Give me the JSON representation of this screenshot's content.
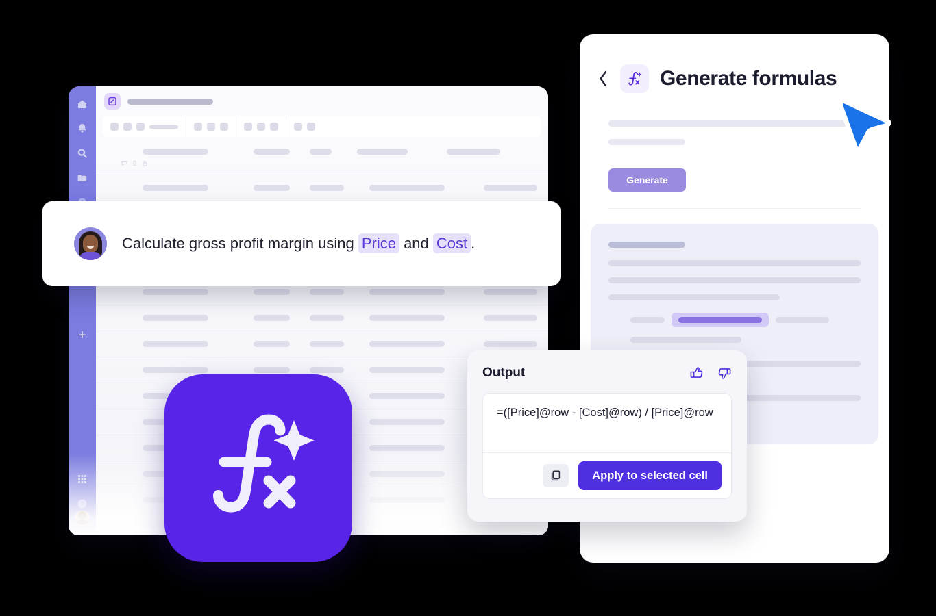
{
  "spreadsheet": {
    "sidebar": {
      "items": [
        {
          "name": "home-icon"
        },
        {
          "name": "notifications-bell-icon"
        },
        {
          "name": "search-icon"
        },
        {
          "name": "folder-icon"
        },
        {
          "name": "recents-clock-icon"
        }
      ],
      "add_label": "+",
      "bottom_items": [
        {
          "name": "apps-grid-icon"
        },
        {
          "name": "help-icon"
        }
      ],
      "avatar_name": "user-avatar"
    },
    "doc_icon_name": "sheet-document-icon",
    "toolbar_groups": [
      3,
      3,
      3,
      2
    ]
  },
  "panel": {
    "back_icon": "chevron-left-icon",
    "badge_icon": "formula-sparkle-icon",
    "title": "Generate formulas",
    "generate_label": "Generate"
  },
  "bubble": {
    "avatar_name": "person-avatar",
    "text_before": "Calculate gross profit margin using ",
    "chip_1": "Price",
    "text_middle": " and ",
    "chip_2": "Cost",
    "text_after": "."
  },
  "fx_app": {
    "icon_name": "formula-sparkle-app-icon"
  },
  "output": {
    "title": "Output",
    "thumbs_up_icon": "thumbs-up-icon",
    "thumbs_down_icon": "thumbs-down-icon",
    "formula": "=([Price]@row - [Cost]@row) / [Price]@row",
    "copy_icon": "copy-icon",
    "apply_label": "Apply to selected cell"
  },
  "cursor": {
    "name": "mouse-pointer-cursor",
    "color": "#1a73e8"
  },
  "colors": {
    "brand_purple": "#5724e8",
    "apply_purple": "#4f2fe0",
    "generate_purple": "#9b8ae0",
    "sidebar_purple": "#7b7be0",
    "chip_bg": "#e7e0fb",
    "chip_text": "#5b39d8"
  }
}
